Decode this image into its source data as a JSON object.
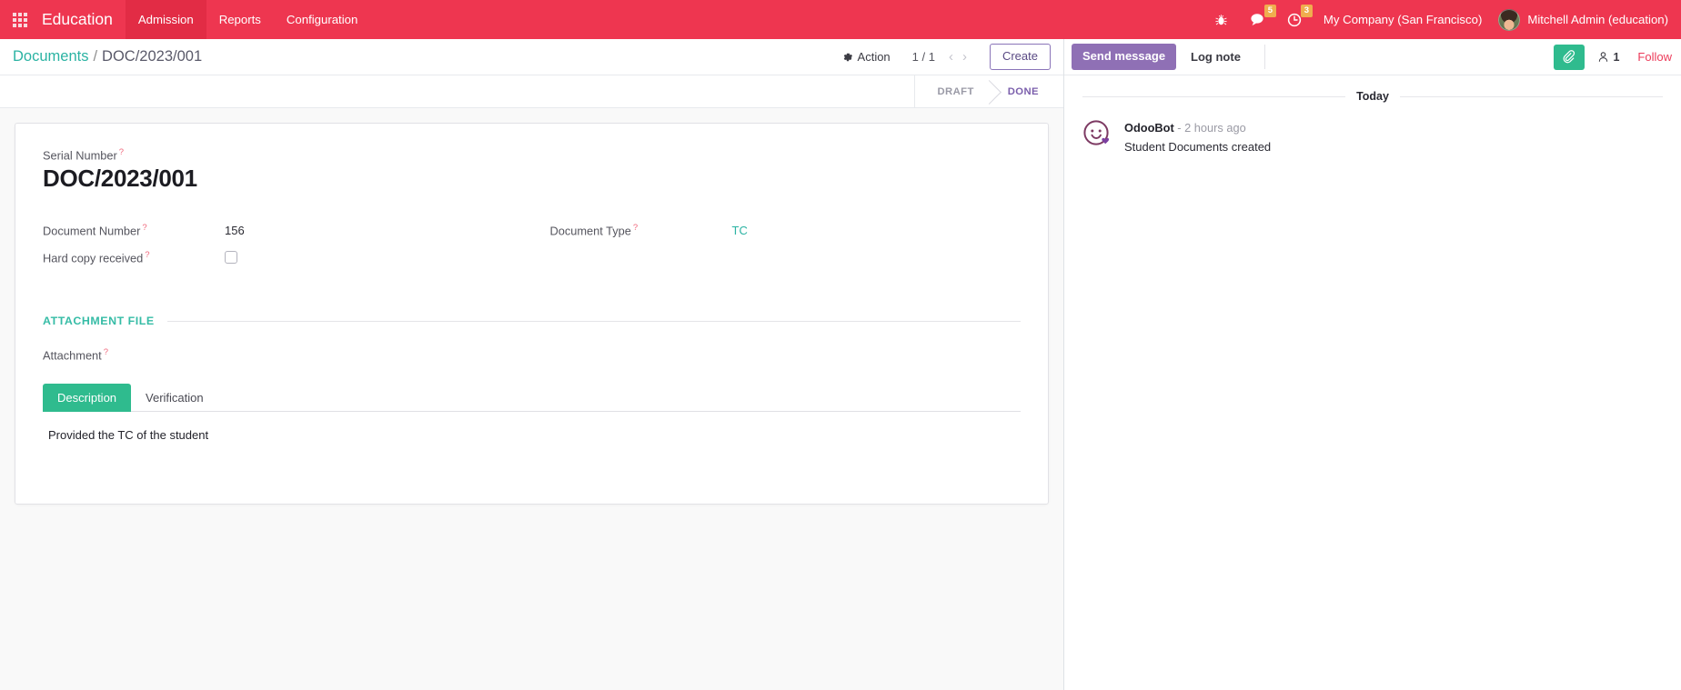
{
  "navbar": {
    "apps_icon": "apps-grid-icon",
    "brand": "Education",
    "menus": [
      {
        "label": "Admission",
        "active": true
      },
      {
        "label": "Reports",
        "active": false
      },
      {
        "label": "Configuration",
        "active": false
      }
    ],
    "bug_icon": "bug-icon",
    "messages_icon": "messages-icon",
    "messages_count": "5",
    "activity_icon": "clock-icon",
    "activity_count": "3",
    "company": "My Company (San Francisco)",
    "user": "Mitchell Admin (education)",
    "accent_color": "#ee3650",
    "badge_color": "#f0ad4e"
  },
  "control_panel": {
    "breadcrumb_root": "Documents",
    "breadcrumb_sep": "/",
    "breadcrumb_current": "DOC/2023/001",
    "action_label": "Action",
    "action_icon": "gear-icon",
    "pager": "1 / 1",
    "prev_icon": "chevron-left-icon",
    "next_icon": "chevron-right-icon",
    "create_label": "Create"
  },
  "statusbar": {
    "stages": [
      {
        "label": "DRAFT",
        "active": false
      },
      {
        "label": "DONE",
        "active": true
      }
    ],
    "active_color": "#7b5fac"
  },
  "form": {
    "serial_number_label": "Serial Number",
    "serial_number_value": "DOC/2023/001",
    "document_number_label": "Document Number",
    "document_number_value": "156",
    "document_type_label": "Document Type",
    "document_type_value": "TC",
    "hard_copy_label": "Hard copy received",
    "hard_copy_checked": false,
    "section_title": "ATTACHMENT FILE",
    "attachment_label": "Attachment",
    "tooltip_marker": "?",
    "section_color": "#36bca6",
    "link_color": "#2bb3a3"
  },
  "notebook": {
    "tabs": [
      {
        "label": "Description",
        "active": true
      },
      {
        "label": "Verification",
        "active": false
      }
    ],
    "description_text": "Provided the TC of the student",
    "active_tab_color": "#2fbb8e"
  },
  "chatter": {
    "send_message_label": "Send message",
    "log_note_label": "Log note",
    "attach_icon": "paperclip-icon",
    "followers_icon": "user-icon",
    "followers_count": "1",
    "follow_label": "Follow",
    "day_separator": "Today",
    "messages": [
      {
        "avatar": "odoobot-avatar",
        "author": "OdooBot",
        "time": "- 2 hours ago",
        "text": "Student Documents created"
      }
    ]
  }
}
